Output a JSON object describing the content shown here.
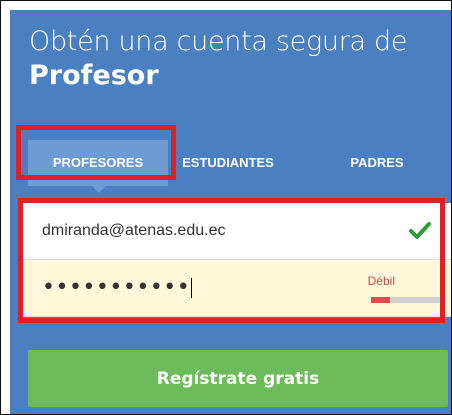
{
  "header": {
    "title_line1": "Obtén una cuenta segura de",
    "title_line2": "Profesor"
  },
  "tabs": [
    {
      "label": "PROFESORES",
      "active": true
    },
    {
      "label": "ESTUDIANTES",
      "active": false
    },
    {
      "label": "PADRES",
      "active": false
    }
  ],
  "form": {
    "email_value": "dmiranda@atenas.edu.ec",
    "email_valid_icon": "check-icon",
    "password_masked": "•••••••••••",
    "password_strength_label": "Débil",
    "password_strength_fraction": 0.25
  },
  "register_button_label": "Regístrate gratis",
  "colors": {
    "panel_bg": "#4a7fc1",
    "active_tab_bg": "#6d9bd4",
    "highlight_border": "#e02027",
    "check_green": "#2f9e3a",
    "strength_weak": "#e24b4b",
    "button_green": "#6dbb5a"
  }
}
